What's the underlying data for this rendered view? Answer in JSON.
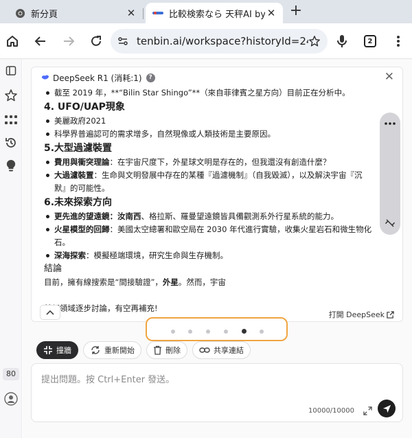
{
  "browser": {
    "tabs": [
      {
        "label": "新分頁",
        "icon": "chrome-icon"
      },
      {
        "label": "比較検索なら 天秤AI byGMO",
        "icon": "tenbin-favicon"
      }
    ],
    "url": "tenbin.ai/workspace?historyId=24526",
    "tab_count": "2"
  },
  "sidebar": {
    "counter": "80"
  },
  "panel": {
    "title": "DeepSeek R1 (消耗:1)",
    "help": "?",
    "open_link": "打開 DeepSeek"
  },
  "content": {
    "l01": "截至 2019 年，**“Bilin Star Shingo”**（來自菲律賓之星方向）目前正在分析中。",
    "h4": "4. UFO/UAP現象",
    "l02": "美麗政府2021",
    "l03": "科學界普遍認可的需求增多，自然現像或人類技術是主要原因。",
    "h5": "5.大型過濾裝置",
    "l04_b": "費用與衝突理論",
    "l04": "：在宇宙尺度下，外星球文明是存在的，但我還沒有創造什麼？",
    "l05_b": "大過濾裝置",
    "l05": "：生命與文明發展中存在的某種『過濾機制』（自我毀滅），以及解決宇宙『沉默』的可能性。",
    "h6": "6.未來探索方向",
    "l06_b": "更先進的望遠鏡：汝南西",
    "l06": "、格拉斯、羅曼望遠鏡皆具備觀測系外行星系統的能力。",
    "l07_b": "火星模型的回歸",
    "l07": "：美國太空總署和歐空局在 2030 年代進行實驗，收集火星岩石和微生物化石。",
    "l08_b": "深海探索",
    "l08": "：模擬極端環境，研究生命與生存機制。",
    "conclusion_title": "結論",
    "conc_a": "目前，擁有線搜索是“間接驗證”，",
    "conc_b": "外星",
    "conc_c": "。然而，宇宙",
    "final": "某個領域逐步討論，有空再補充!"
  },
  "pager": {
    "total": 6,
    "active": 5
  },
  "actions": {
    "collapse": "撞牆",
    "restart": "重新開始",
    "delete": "刪除",
    "share": "共享連結"
  },
  "input": {
    "placeholder": "提出問題。按 Ctrl+Enter 發送。",
    "count": "10000/10000"
  }
}
